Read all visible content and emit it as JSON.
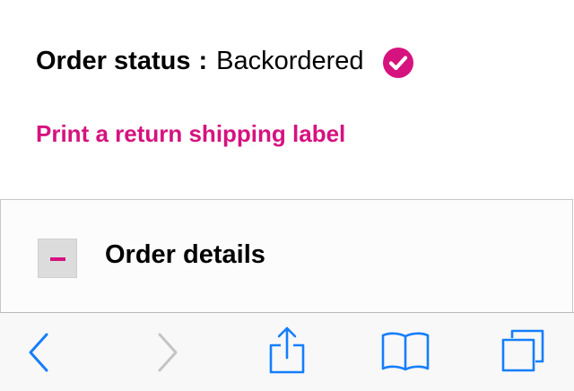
{
  "order": {
    "status_label": "Order status",
    "separator": ":",
    "status_value": "Backordered",
    "status_icon": "checkmark-circle-icon"
  },
  "links": {
    "return_label": "Print a return shipping label"
  },
  "details": {
    "title": "Order details",
    "toggle_icon": "minus-icon"
  },
  "toolbar": {
    "back_icon": "chevron-left-icon",
    "forward_icon": "chevron-right-icon",
    "share_icon": "share-icon",
    "bookmarks_icon": "book-icon",
    "tabs_icon": "tabs-icon"
  },
  "colors": {
    "accent": "#d6127f",
    "toolbar_blue": "#157efb",
    "toolbar_disabled": "#c4c4c7"
  }
}
